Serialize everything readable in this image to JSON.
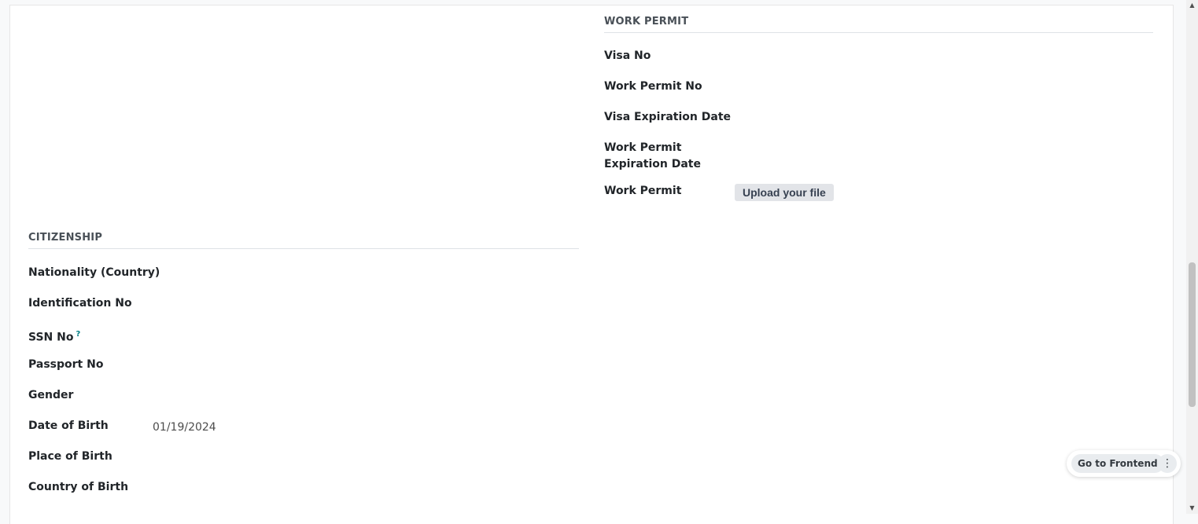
{
  "work_permit": {
    "title": "WORK PERMIT",
    "visa_no": "Visa No",
    "work_permit_no": "Work Permit No",
    "visa_expiration": "Visa Expiration Date",
    "wp_expiration_line1": "Work Permit",
    "wp_expiration_line2": "Expiration Date",
    "work_permit": "Work Permit",
    "upload_label": "Upload your file"
  },
  "citizenship": {
    "title": "CITIZENSHIP",
    "nationality": "Nationality (Country)",
    "identification_no": "Identification No",
    "ssn_no": "SSN No",
    "ssn_help": "?",
    "passport_no": "Passport No",
    "gender": "Gender",
    "date_of_birth": "Date of Birth",
    "date_of_birth_value": "01/19/2024",
    "place_of_birth": "Place of Birth",
    "country_of_birth": "Country of Birth"
  },
  "floating": {
    "go_to_frontend": "Go to Frontend",
    "more_icon": "⋮"
  },
  "scrollbar": {
    "position_fraction": 0.51
  }
}
